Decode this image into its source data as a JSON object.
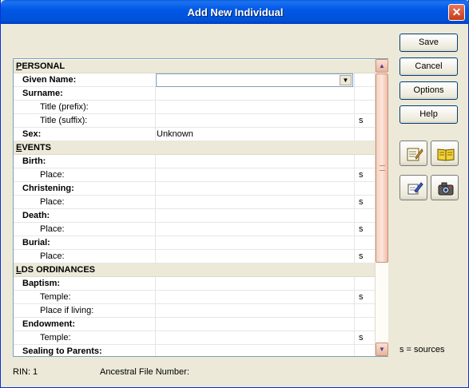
{
  "window": {
    "title": "Add New Individual",
    "close_glyph": "✕"
  },
  "buttons": {
    "save": "Save",
    "cancel": "Cancel",
    "options": "Options",
    "help": "Help"
  },
  "icon_buttons": [
    {
      "name": "notes-icon"
    },
    {
      "name": "book-icon"
    },
    {
      "name": "edit-icon"
    },
    {
      "name": "camera-icon"
    }
  ],
  "grid": {
    "sections": {
      "personal": {
        "label": "PERSONAL",
        "hotkey": "P",
        "rest": "ERSONAL"
      },
      "events": {
        "label": "EVENTS",
        "hotkey": "E",
        "rest": "VENTS"
      },
      "lds": {
        "label": "LDS ORDINANCES",
        "hotkey": "L",
        "rest": "DS ORDINANCES"
      }
    },
    "rows": {
      "given_name": "Given Name:",
      "surname": "Surname:",
      "title_prefix": "Title (prefix):",
      "title_suffix": "Title (suffix):",
      "title_suffix_s": "s",
      "sex": "Sex:",
      "sex_value": "Unknown",
      "birth": "Birth:",
      "birth_place": "Place:",
      "birth_place_s": "s",
      "christening": "Christening:",
      "christening_place": "Place:",
      "christening_place_s": "s",
      "death": "Death:",
      "death_place": "Place:",
      "death_place_s": "s",
      "burial": "Burial:",
      "burial_place": "Place:",
      "burial_place_s": "s",
      "baptism": "Baptism:",
      "baptism_temple": "Temple:",
      "baptism_temple_s": "s",
      "baptism_place_living": "Place if living:",
      "endowment": "Endowment:",
      "endowment_temple": "Temple:",
      "endowment_temple_s": "s",
      "sealing_parents": "Sealing to Parents:"
    },
    "given_name_value": "",
    "scroll_up": "▲",
    "scroll_down": "▼",
    "combo_arrow": "▼"
  },
  "legend": "s = sources",
  "status": {
    "rin": "RIN: 1",
    "ancestral_file": "Ancestral File Number:"
  }
}
